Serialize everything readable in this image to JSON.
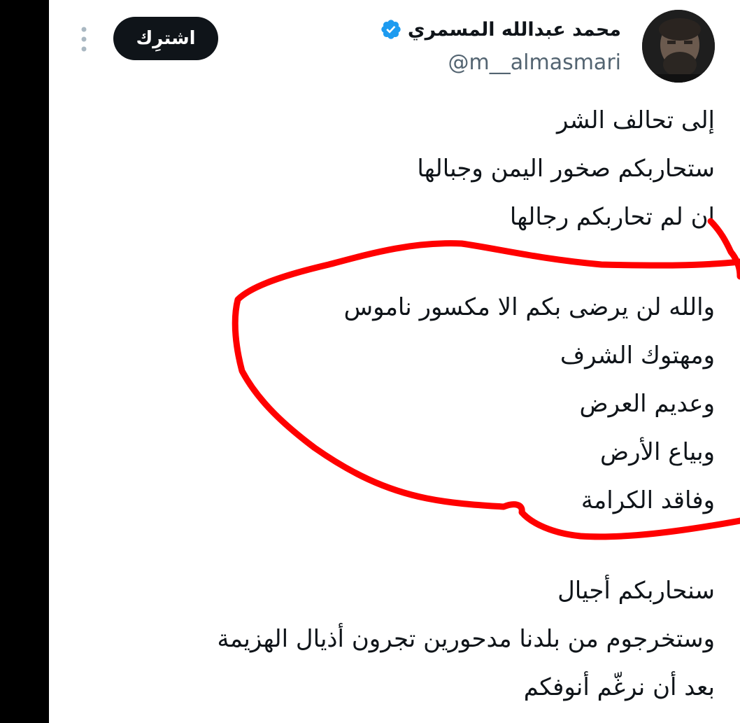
{
  "author": {
    "display_name": "محمد عبدالله المسمري",
    "handle": "@m__almasmari",
    "verified_icon": "verified-badge-icon",
    "verified_color": "#1d9bf0"
  },
  "actions": {
    "subscribe_label": "اشترِك",
    "more_icon": "more-vertical-icon"
  },
  "tweet": {
    "lines": [
      "إلى تحالف الشر",
      "ستحاربكم صخور اليمن وجبالها",
      "ان لم تحاربكم رجالها",
      "",
      "والله لن يرضى بكم الا مكسور ناموس",
      "ومهتوك الشرف",
      "وعديم العرض",
      "وبياع الأرض",
      "وفاقد الكرامة",
      "",
      "سنحاربكم أجيال",
      "وستخرجوم من بلدنا مدحورين تجرون أذيال الهزيمة",
      "بعد أن نرغّم أنوفكم"
    ]
  },
  "annotation": {
    "stroke_color": "#ff0000"
  }
}
